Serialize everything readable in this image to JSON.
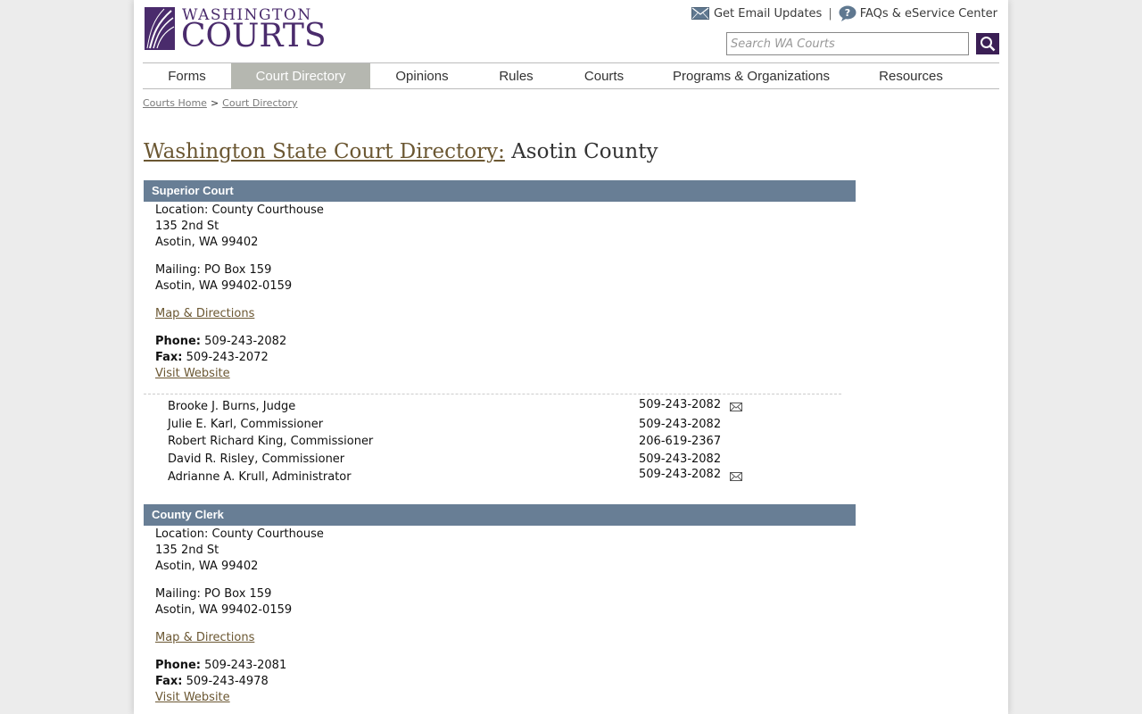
{
  "header": {
    "logo_top": "WASHINGTON",
    "logo_bottom": "COURTS",
    "email_updates": "Get Email Updates",
    "separator": "|",
    "faqs": "FAQs & eService Center",
    "search_placeholder": "Search WA Courts"
  },
  "nav": {
    "items": [
      "Forms",
      "Court Directory",
      "Opinions",
      "Rules",
      "Courts",
      "Programs & Organizations",
      "Resources"
    ],
    "active": "Court Directory"
  },
  "breadcrumb": {
    "home": "Courts Home",
    "sep": ">",
    "current": "Court Directory"
  },
  "title": {
    "link": "Washington State Court Directory:",
    "county": "Asotin County"
  },
  "sections": [
    {
      "name": "Superior Court",
      "location": "Location: County Courthouse",
      "street": "135 2nd St",
      "city": "Asotin, WA 99402",
      "mailing": "Mailing: PO Box 159",
      "mailing_city": "Asotin, WA 99402-0159",
      "map": "Map & Directions",
      "phone_label": "Phone:",
      "phone": "509-243-2082",
      "fax_label": "Fax:",
      "fax": "509-243-2072",
      "website": "Visit Website",
      "staff": [
        {
          "name": "Brooke J. Burns, Judge",
          "phone": "509-243-2082",
          "email": true
        },
        {
          "name": "Julie E. Karl, Commissioner",
          "phone": "509-243-2082",
          "email": false
        },
        {
          "name": "Robert Richard King, Commissioner",
          "phone": "206-619-2367",
          "email": false
        },
        {
          "name": "David R. Risley, Commissioner",
          "phone": "509-243-2082",
          "email": false
        },
        {
          "name": "Adrianne A. Krull, Administrator",
          "phone": "509-243-2082",
          "email": true
        }
      ]
    },
    {
      "name": "County Clerk",
      "location": "Location: County Courthouse",
      "street": "135 2nd St",
      "city": "Asotin, WA 99402",
      "mailing": "Mailing: PO Box 159",
      "mailing_city": "Asotin, WA 99402-0159",
      "map": "Map & Directions",
      "phone_label": "Phone:",
      "phone": "509-243-2081",
      "fax_label": "Fax:",
      "fax": "509-243-4978",
      "website": "Visit Website"
    }
  ],
  "colors": {
    "brand_purple": "#4a2b6c",
    "section_bar": "#687e95",
    "nav_active": "#b5b7b0",
    "link": "#6b5732"
  }
}
